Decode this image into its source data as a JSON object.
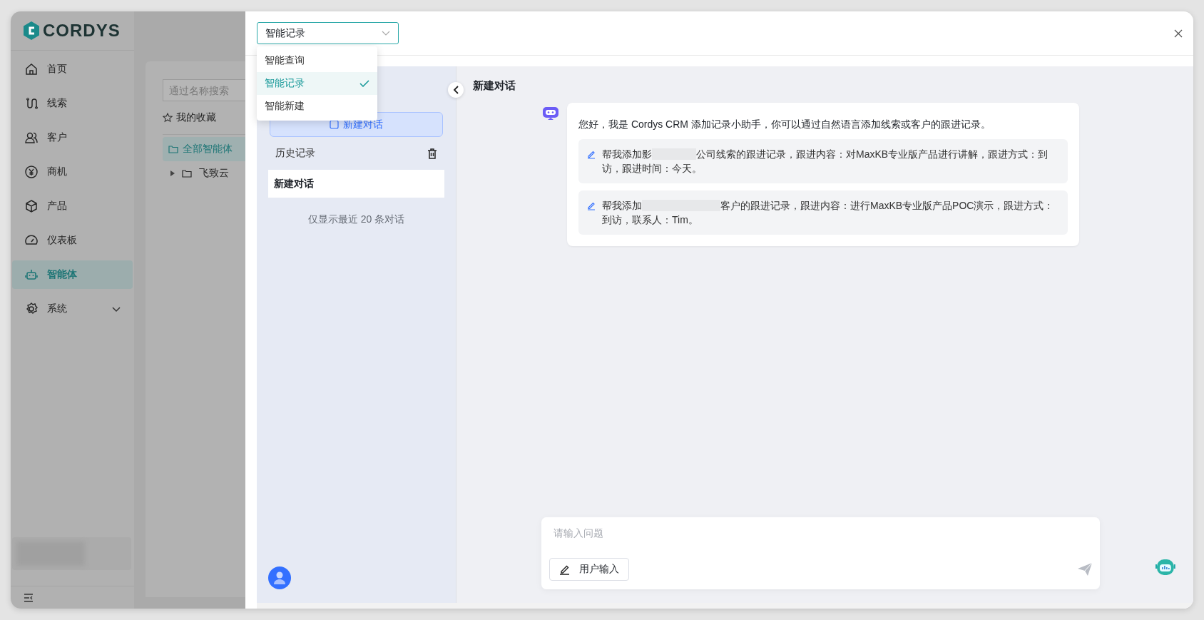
{
  "app": {
    "logo": "CORDYS"
  },
  "nav": [
    {
      "label": "首页",
      "selected": false
    },
    {
      "label": "线索",
      "selected": false
    },
    {
      "label": "客户",
      "selected": false
    },
    {
      "label": "商机",
      "selected": false
    },
    {
      "label": "产品",
      "selected": false
    },
    {
      "label": "仪表板",
      "selected": false
    },
    {
      "label": "智能体",
      "selected": true
    },
    {
      "label": "系统",
      "selected": false,
      "expandable": true
    }
  ],
  "agent_panel": {
    "search": {
      "placeholder": "通过名称搜索"
    },
    "favorites": "我的收藏",
    "folders": [
      {
        "label": "全部智能体",
        "selected": true,
        "kind": "root"
      },
      {
        "label": "飞致云",
        "selected": false,
        "kind": "group",
        "expanded": false
      }
    ]
  },
  "agent_select": {
    "value": "智能记录",
    "open": true,
    "options": [
      {
        "label": "智能查询",
        "selected": false
      },
      {
        "label": "智能记录",
        "selected": true
      },
      {
        "label": "智能新建",
        "selected": false
      }
    ]
  },
  "history": {
    "new_button": "新建对话",
    "title": "历史记录",
    "items": [
      {
        "label": "新建对话",
        "selected": true
      }
    ],
    "note": "仅显示最近 20 条对话"
  },
  "chat": {
    "title": "新建对话",
    "greeting": "您好，我是 Cordys CRM 添加记录小助手，你可以通过自然语言添加线索或客户的跟进记录。",
    "suggestions": [
      {
        "before": "帮我添加影",
        "after": "公司线索的跟进记录，跟进内容：对MaxKB专业版产品进行讲解，跟进方式：到",
        "line_2": "访，跟进时间：今天。"
      },
      {
        "before": "帮我添加",
        "after": "客户的跟进记录，跟进内容：进行MaxKB专业版产品POC演示，跟进方式：",
        "line_2": "到访，联系人：Tim。"
      }
    ],
    "input": {
      "placeholder": "请输入问题",
      "mode_button": "用户输入"
    }
  }
}
